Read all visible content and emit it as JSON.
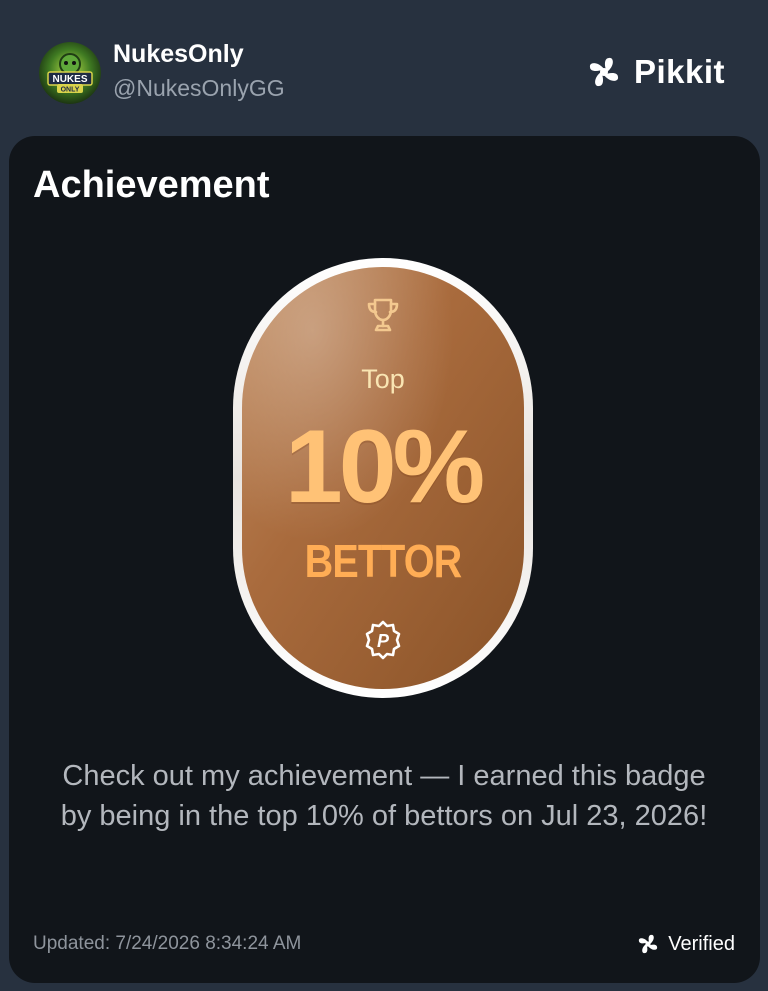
{
  "header": {
    "user_name": "NukesOnly",
    "user_handle": "@NukesOnlyGG",
    "avatar_text_1": "NUKES",
    "avatar_text_2": "ONLY",
    "brand_name": "Pikkit",
    "brand_icon": "clover-icon"
  },
  "card": {
    "title": "Achievement",
    "badge": {
      "icon_top": "trophy-icon",
      "top_label": "Top",
      "percent": "10%",
      "bettor_label": "BETTOR",
      "icon_bottom": "p-badge-icon",
      "bottom_glyph": "P"
    },
    "description": "Check out my achievement — I earned this badge by being in the top 10% of bettors on Jul 23, 2026!",
    "updated": "Updated: 7/24/2026 8:34:24 AM",
    "verified_label": "Verified",
    "verified_icon": "clover-icon"
  },
  "colors": {
    "page_bg": "#27313f",
    "card_bg": "#11151a",
    "badge_bronze": "#a4693b",
    "badge_text": "#ffc276"
  }
}
